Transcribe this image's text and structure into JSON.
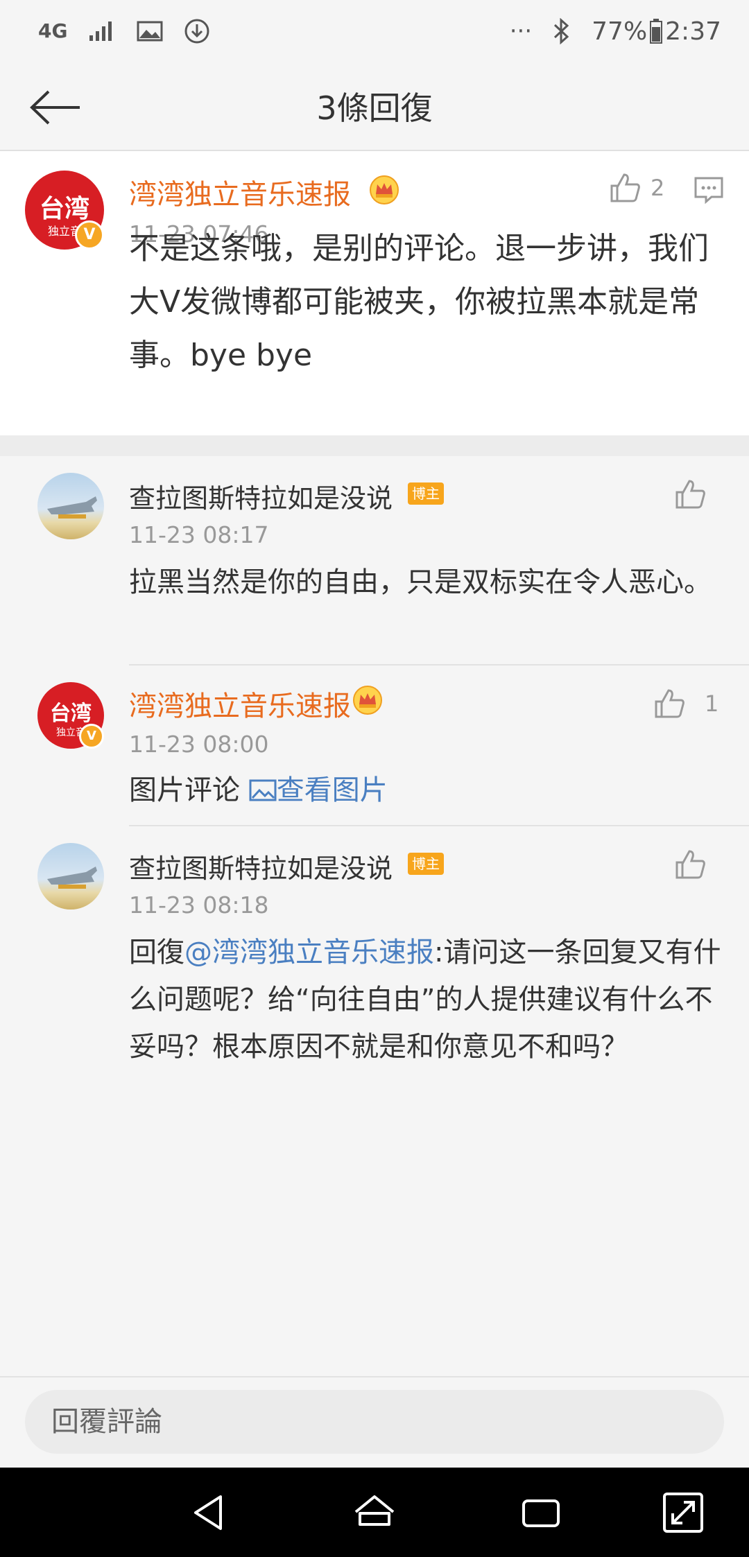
{
  "status_bar": {
    "network": "4G",
    "battery": "77%",
    "time": "2:37",
    "more": "···"
  },
  "header": {
    "title": "3條回復"
  },
  "main_comment": {
    "avatar_text": "台湾",
    "avatar_sub": "独立音",
    "username": "湾湾独立音乐速报",
    "time": "11-23 07:46",
    "likes": "2",
    "text": "不是这条哦，是别的评论。退一步讲，我们大V发微博都可能被夹，你被拉黑本就是常事。bye bye"
  },
  "replies": [
    {
      "username": "查拉图斯特拉如是没说",
      "tag": "博主",
      "time": "11-23 08:17",
      "text": "拉黑当然是你的自由，只是双标实在令人恶心。"
    },
    {
      "avatar_text": "台湾",
      "avatar_sub": "独立音",
      "username": "湾湾独立音乐速报",
      "time": "11-23 08:00",
      "likes": "1",
      "text_prefix": "图片评论 ",
      "link": "查看图片"
    },
    {
      "username": "查拉图斯特拉如是没说",
      "tag": "博主",
      "time": "11-23 08:18",
      "reply_prefix": "回復",
      "mention": "@湾湾独立音乐速报",
      "text": ":请问这一条回复又有什么问题呢？给“向往自由”的人提供建议有什么不妥吗？根本原因不就是和你意见不和吗？"
    }
  ],
  "input": {
    "placeholder": "回覆評論"
  },
  "colors": {
    "accent_orange": "#e86b1f",
    "link_blue": "#4a7fc1",
    "brand_red": "#d71e24"
  }
}
